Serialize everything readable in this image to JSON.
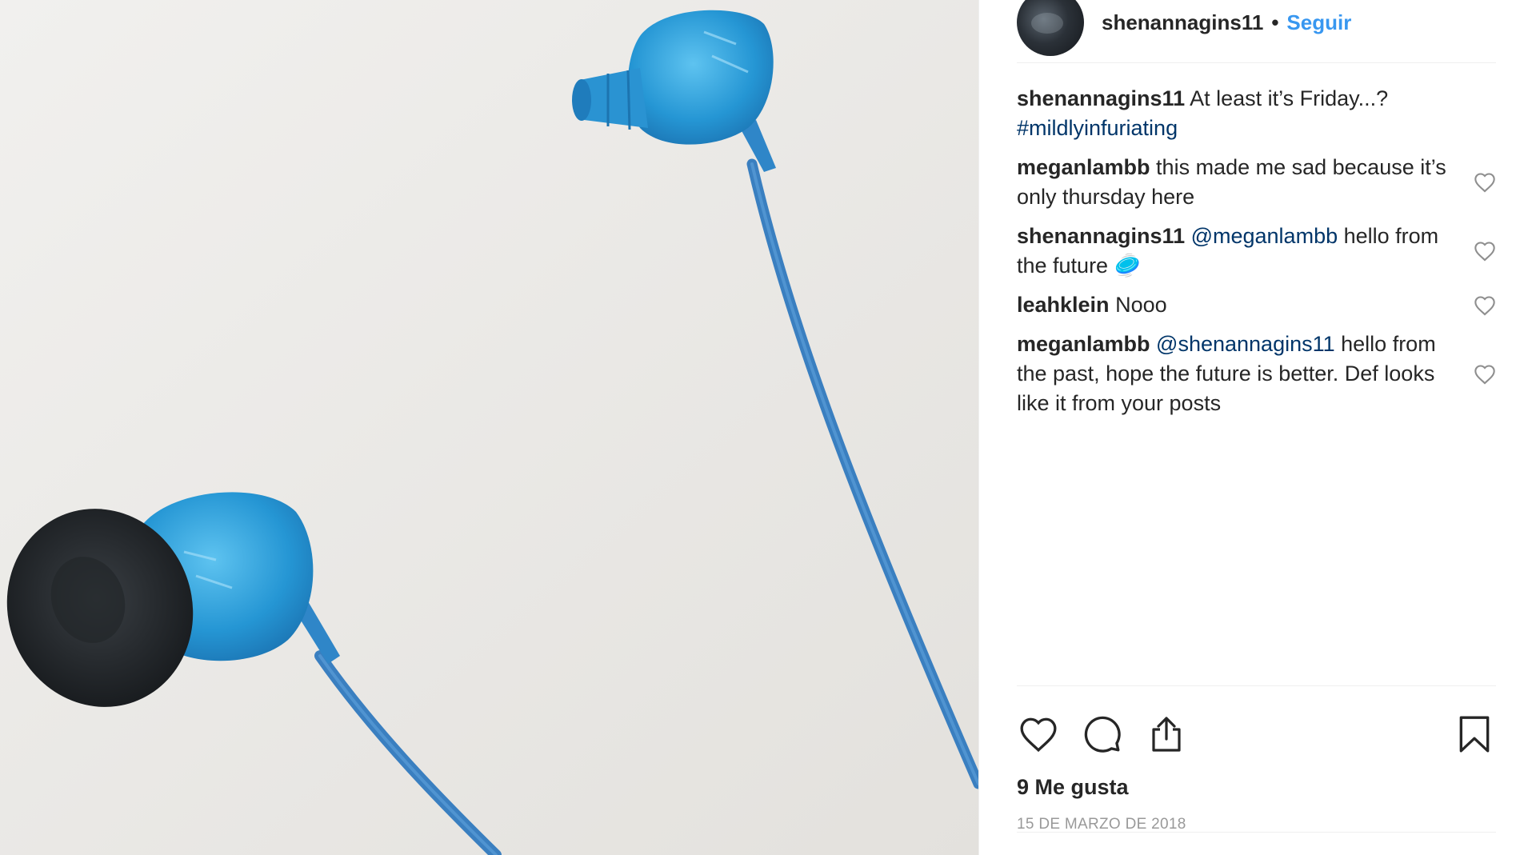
{
  "post": {
    "author": "shenannagins11",
    "separator": "•",
    "follow_label": "Seguir",
    "caption": {
      "user": "shenannagins11",
      "text": " At least it’s Friday...? ",
      "hashtag": "#mildlyinfuriating"
    },
    "comments": [
      {
        "user": "meganlambb",
        "mention": "",
        "text": " this made me sad because it’s only thursday here"
      },
      {
        "user": "shenannagins11",
        "mention": " @meganlambb",
        "text": " hello from the future 🥏"
      },
      {
        "user": "leahklein",
        "mention": "",
        "text": " Nooo"
      },
      {
        "user": "meganlambb",
        "mention": " @shenannagins11",
        "text": " hello from the past, hope the future is better. Def looks like it from your posts"
      }
    ],
    "likes_label": "9 Me gusta",
    "date_label": "15 de marzo de 2018"
  },
  "icons": {
    "like": "heart-icon",
    "comment": "comment-icon",
    "share": "share-icon",
    "save": "bookmark-icon",
    "comment_like": "heart-outline-icon"
  },
  "colors": {
    "link": "#003569",
    "follow": "#3897f0",
    "muted": "#999999",
    "text": "#262626"
  }
}
